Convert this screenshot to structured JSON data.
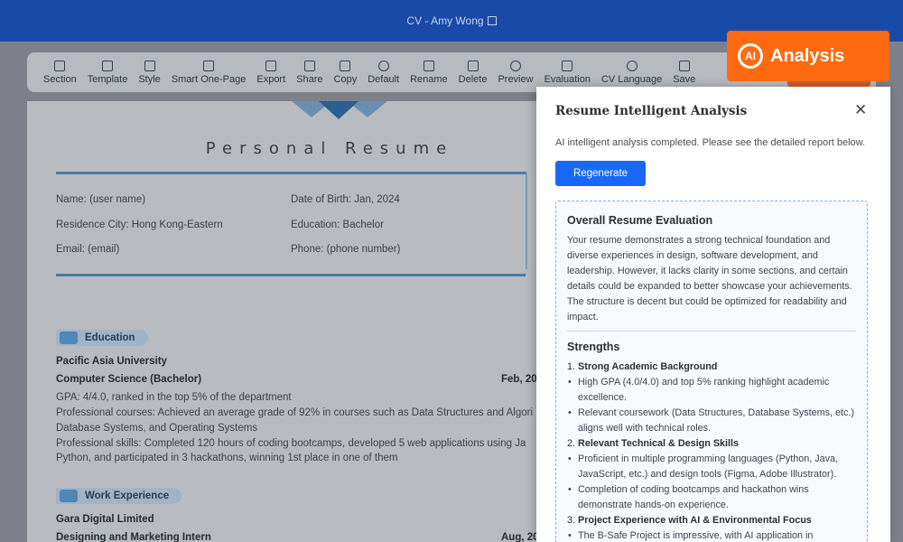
{
  "window": {
    "title": "CV - Amy Wong"
  },
  "toolbar": {
    "items": [
      {
        "label": "Section",
        "icon": "grid-icon"
      },
      {
        "label": "Template",
        "icon": "template-icon"
      },
      {
        "label": "Style",
        "icon": "style-icon"
      },
      {
        "label": "Smart One-Page",
        "icon": "page-icon"
      },
      {
        "label": "Export",
        "icon": "export-icon"
      },
      {
        "label": "Share",
        "icon": "share-icon"
      },
      {
        "label": "Copy",
        "icon": "copy-icon"
      },
      {
        "label": "Default",
        "icon": "check-circle-icon"
      },
      {
        "label": "Rename",
        "icon": "rename-icon"
      },
      {
        "label": "Delete",
        "icon": "trash-icon"
      },
      {
        "label": "Preview",
        "icon": "eye-icon"
      },
      {
        "label": "Evaluation",
        "icon": "evaluation-icon"
      },
      {
        "label": "CV Language",
        "icon": "globe-icon"
      },
      {
        "label": "Save",
        "icon": "save-icon"
      }
    ]
  },
  "resume": {
    "title": "Personal Resume",
    "info": {
      "name": "Name:  (user name)",
      "dob": "Date of Birth:  Jan, 2024",
      "city": "Residence City:  Hong Kong-Eastern",
      "education": "Education:  Bachelor",
      "email": "Email:  (email)",
      "phone": "Phone:  (phone number)"
    },
    "education": {
      "heading": "Education",
      "school": "Pacific Asia University",
      "major": "Computer Science  (Bachelor)",
      "date": "Feb, 20",
      "lines": [
        "GPA: 4/4.0, ranked in the top 5% of the department",
        "Professional courses: Achieved an average grade of 92% in courses such as Data Structures and Algori",
        "Database Systems, and Operating Systems",
        "Professional skills: Completed 120 hours of coding bootcamps, developed 5 web applications using Ja",
        "Python, and participated in 3 hackathons, winning 1st place in one of them"
      ]
    },
    "work": {
      "heading": "Work Experience",
      "company": "Gara Digital Limited",
      "role": "Designing and Marketing Intern",
      "date": "Aug, 20"
    }
  },
  "badge": {
    "label": "Analysis"
  },
  "analysis": {
    "title": "Resume Intelligent Analysis",
    "subtitle": "AI intelligent analysis completed. Please see the detailed report below.",
    "regenerate_label": "Regenerate",
    "overall_heading": "Overall Resume Evaluation",
    "overall_text": "Your resume demonstrates a strong technical foundation and diverse experiences in design, software development, and leadership. However, it lacks clarity in some sections, and certain details could be expanded to better showcase your achievements. The structure is decent but could be optimized for readability and impact.",
    "strengths_heading": "Strengths",
    "strengths": [
      {
        "num": "1.",
        "title": "Strong Academic Background",
        "bullets": [
          "High GPA (4.0/4.0) and top 5% ranking highlight academic excellence.",
          "Relevant coursework (Data Structures, Database Systems, etc.) aligns well with technical roles."
        ]
      },
      {
        "num": "2.",
        "title": "Relevant Technical & Design Skills",
        "bullets": [
          "Proficient in multiple programming languages (Python, Java, JavaScript, etc.) and design tools (Figma, Adobe Illustrator).",
          "Completion of coding bootcamps and hackathon wins demonstrate hands-on experience."
        ]
      },
      {
        "num": "3.",
        "title": "Project Experience with AI & Environmental Focus",
        "bullets": [
          "The B-Safe Project is impressive, with AI application in"
        ]
      }
    ]
  }
}
